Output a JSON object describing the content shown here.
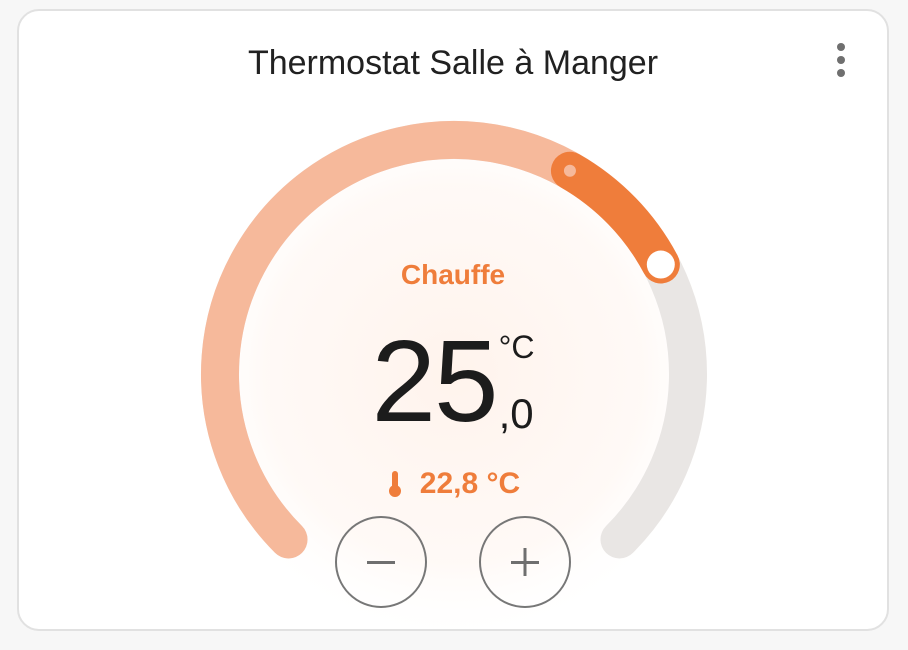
{
  "card": {
    "title": "Thermostat Salle à Manger",
    "menu_icon": "more-vertical-icon"
  },
  "thermostat": {
    "mode_label": "Chauffe",
    "target_integer": "25",
    "target_decimal": ",0",
    "target_unit": "°C",
    "current_temperature": "22,8 °C",
    "current_icon": "thermometer-icon",
    "decrease_icon": "minus-icon",
    "increase_icon": "plus-icon",
    "setpoint_fraction": 0.73,
    "current_fraction": 0.61
  },
  "colors": {
    "accent": "#ef7d3b",
    "accent_light": "#f6b99b",
    "track": "#e9e6e4",
    "text": "#1c1c1c"
  }
}
